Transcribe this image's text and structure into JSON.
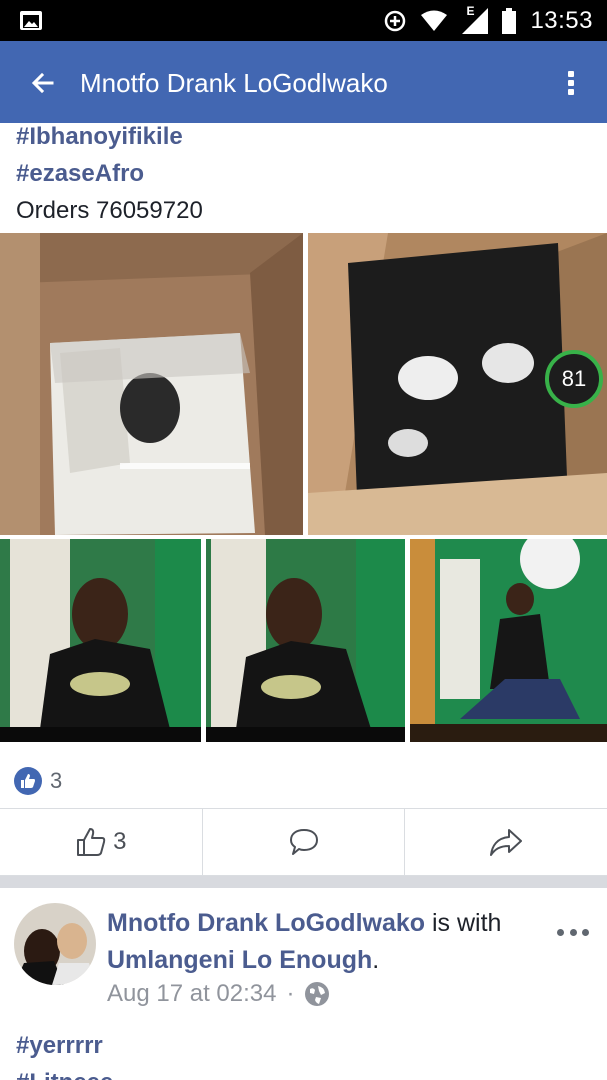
{
  "status_bar": {
    "time": "13:53",
    "network_type": "E",
    "icons": [
      "gallery-icon",
      "data-saver-icon",
      "wifi-icon",
      "signal-icon",
      "battery-icon"
    ]
  },
  "app_bar": {
    "title": "Mnotfo Drank LoGodlwako",
    "icons": [
      "back-arrow-icon",
      "more-vertical-icon"
    ],
    "color": "#4267b2"
  },
  "post": {
    "hashtags": [
      "#Ibhanoyifikile",
      "#ezaseAfro"
    ],
    "orders_text": "Orders 76059720",
    "photo_badge": "81",
    "reactions": {
      "like_count": "3"
    },
    "actions": {
      "like_count": "3",
      "icons": [
        "thumbs-up-icon",
        "comment-icon",
        "share-icon"
      ]
    }
  },
  "next_post": {
    "author": "Mnotfo Drank LoGodlwako",
    "with_text": " is with",
    "tagged": "Umlangeni Lo Enough",
    "end_punct": ".",
    "timestamp": "Aug 17 at 02:34",
    "separator": "·",
    "privacy_icon": "globe-icon",
    "hashtags": [
      "#yerrrrr",
      "#Litneee"
    ]
  },
  "colors": {
    "hashtag": "#4b5c8f",
    "meta": "#90949c",
    "badge_ring": "#38b249"
  }
}
